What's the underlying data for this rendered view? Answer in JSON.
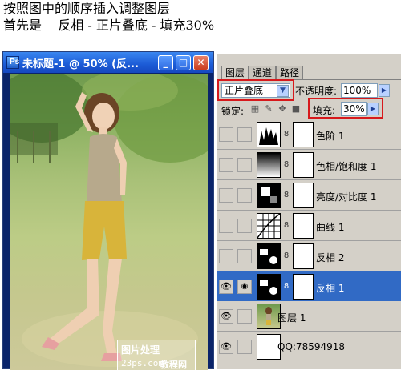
{
  "instructions": {
    "line1": "按照图中的顺序插入调整图层",
    "line2": "首先是    反相 - 正片叠底 - 填充30%"
  },
  "document_window": {
    "title": "未标题-1 @ 50% (反...",
    "app_icon_letter": "Ps",
    "buttons": {
      "minimize": "_",
      "maximize": "□",
      "close": "✕"
    },
    "watermark": {
      "line1": "图片处理",
      "line2": "23ps.com",
      "line3": "教程网"
    }
  },
  "layers_panel": {
    "tabs": [
      "图层",
      "通道",
      "路径"
    ],
    "active_tab": "图层",
    "blend_mode": "正片叠底",
    "opacity_label": "不透明度:",
    "opacity_value": "100%",
    "lock_label": "锁定:",
    "fill_label": "填充:",
    "fill_value": "30%",
    "highlight_color": "#d7191c",
    "selection_color": "#316ac5",
    "layers": [
      {
        "name": "色阶 1",
        "visible": false,
        "thumb": "levels-histogram",
        "selected": false
      },
      {
        "name": "色相/饱和度 1",
        "visible": false,
        "thumb": "gradient",
        "selected": false
      },
      {
        "name": "亮度/对比度 1",
        "visible": false,
        "thumb": "brightness",
        "selected": false
      },
      {
        "name": "曲线 1",
        "visible": false,
        "thumb": "curves-grid",
        "selected": false
      },
      {
        "name": "反相 2",
        "visible": false,
        "thumb": "invert",
        "selected": false
      },
      {
        "name": "反相 1",
        "visible": true,
        "thumb": "invert",
        "selected": true
      },
      {
        "name": "图层 1",
        "visible": true,
        "thumb": "photo",
        "selected": false
      },
      {
        "name": "QQ:78594918",
        "visible": true,
        "thumb": "white",
        "selected": false
      }
    ]
  }
}
